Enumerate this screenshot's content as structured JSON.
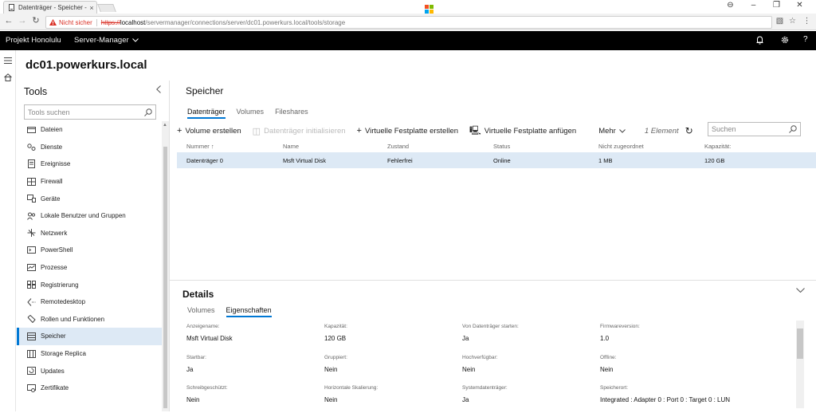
{
  "browser": {
    "tab_title": "Datenträger - Speicher -",
    "tab_close": "×",
    "security_label": "Nicht sicher",
    "url_scheme": "https://",
    "url_host": "localhost",
    "url_path": "/servermanager/connections/server/dc01.powerkurs.local/tools/storage",
    "window_controls": [
      "⊖",
      "–",
      "❐",
      "✕"
    ]
  },
  "appbar": {
    "project": "Projekt Honolulu",
    "server_manager": "Server-Manager",
    "brand": "Microsoft",
    "brand_colors": [
      "#f25022",
      "#7fba00",
      "#00a4ef",
      "#ffb900"
    ]
  },
  "server_title": "dc01.powerkurs.local",
  "tools": {
    "title": "Tools",
    "search_placeholder": "Tools suchen",
    "items": [
      {
        "label": "Dateien",
        "icon": "folder-icon"
      },
      {
        "label": "Dienste",
        "icon": "services-icon"
      },
      {
        "label": "Ereignisse",
        "icon": "events-icon"
      },
      {
        "label": "Firewall",
        "icon": "firewall-icon"
      },
      {
        "label": "Geräte",
        "icon": "devices-icon"
      },
      {
        "label": "Lokale Benutzer und Gruppen",
        "icon": "users-icon"
      },
      {
        "label": "Netzwerk",
        "icon": "network-icon"
      },
      {
        "label": "PowerShell",
        "icon": "powershell-icon"
      },
      {
        "label": "Prozesse",
        "icon": "processes-icon"
      },
      {
        "label": "Registrierung",
        "icon": "registry-icon"
      },
      {
        "label": "Remotedesktop",
        "icon": "remote-desktop-icon"
      },
      {
        "label": "Rollen und Funktionen",
        "icon": "roles-icon"
      },
      {
        "label": "Speicher",
        "icon": "storage-icon"
      },
      {
        "label": "Storage Replica",
        "icon": "storage-replica-icon"
      },
      {
        "label": "Updates",
        "icon": "updates-icon"
      },
      {
        "label": "Zertifikate",
        "icon": "certificates-icon"
      }
    ],
    "active_index": 12
  },
  "main": {
    "title": "Speicher",
    "tabs": [
      "Datenträger",
      "Volumes",
      "Fileshares"
    ],
    "toolbar": {
      "create_volume": "Volume erstellen",
      "init_disk": "Datenträger initialisieren",
      "create_vhd": "Virtuelle Festplatte erstellen",
      "attach_vhd": "Virtuelle Festplatte anfügen",
      "more": "Mehr",
      "count": "1 Element",
      "search_placeholder": "Suchen"
    },
    "columns": [
      "Nummer ↑",
      "Name",
      "Zustand",
      "Status",
      "Nicht zugeordnet",
      "Kapazität:"
    ],
    "rows": [
      [
        "Datenträger 0",
        "Msft Virtual Disk",
        "Fehlerfrei",
        "Online",
        "1 MB",
        "120 GB"
      ]
    ]
  },
  "details": {
    "title": "Details",
    "tabs": [
      "Volumes",
      "Eigenschaften"
    ],
    "properties": [
      [
        {
          "label": "Anzeigename:",
          "value": "Msft Virtual Disk"
        },
        {
          "label": "Kapazität:",
          "value": "120 GB"
        },
        {
          "label": "Von Datenträger starten:",
          "value": "Ja"
        },
        {
          "label": "Firmwareversion:",
          "value": "1.0"
        }
      ],
      [
        {
          "label": "Startbar:",
          "value": "Ja"
        },
        {
          "label": "Gruppiert:",
          "value": "Nein"
        },
        {
          "label": "Hochverfügbar:",
          "value": "Nein"
        },
        {
          "label": "Offline:",
          "value": "Nein"
        }
      ],
      [
        {
          "label": "Schreibgeschützt:",
          "value": "Nein"
        },
        {
          "label": "Horizontale Skalierung:",
          "value": "Nein"
        },
        {
          "label": "Systemdatenträger:",
          "value": "Ja"
        },
        {
          "label": "Speicherort:",
          "value": "Integrated : Adapter 0 : Port 0 : Target 0 : LUN"
        }
      ]
    ]
  }
}
